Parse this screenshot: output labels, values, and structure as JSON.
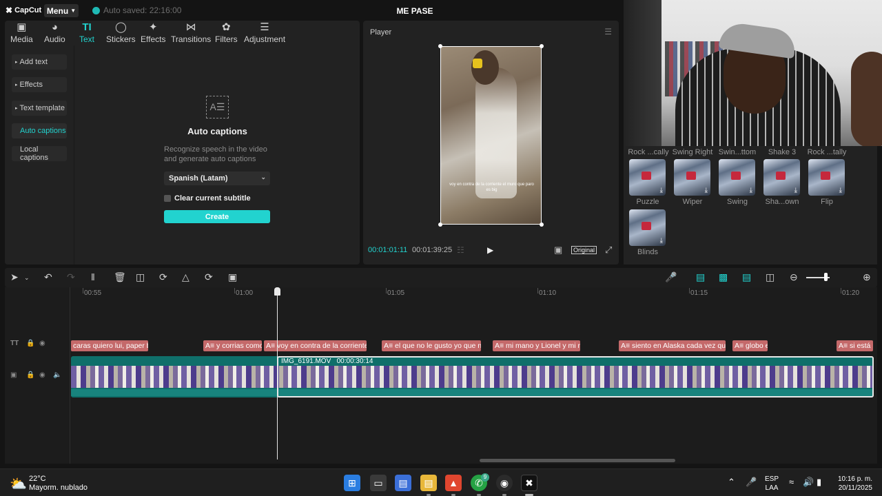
{
  "titlebar": {
    "logo": "CapCut",
    "menu_label": "Menu",
    "autosave": "Auto saved: 22:16:00",
    "project_title": "ME PASE"
  },
  "toolbar": {
    "tabs": [
      {
        "label": "Media",
        "icon": "media-icon"
      },
      {
        "label": "Audio",
        "icon": "audio-icon"
      },
      {
        "label": "Text",
        "icon": "text-icon",
        "active": true
      },
      {
        "label": "Stickers",
        "icon": "stickers-icon"
      },
      {
        "label": "Effects",
        "icon": "effects-icon"
      },
      {
        "label": "Transitions",
        "icon": "transitions-icon"
      },
      {
        "label": "Filters",
        "icon": "filters-icon"
      },
      {
        "label": "Adjustment",
        "icon": "adjustment-icon"
      }
    ]
  },
  "sidebar": {
    "items": [
      {
        "label": "Add text"
      },
      {
        "label": "Effects"
      },
      {
        "label": "Text template"
      },
      {
        "label": "Auto captions",
        "active": true
      },
      {
        "label": "Local captions"
      }
    ]
  },
  "auto_captions": {
    "icon_glyph": "A☰",
    "title": "Auto captions",
    "description": "Recognize speech in the video and generate auto captions",
    "language": "Spanish (Latam)",
    "clear_label": "Clear current subtitle",
    "create_label": "Create"
  },
  "player": {
    "title": "Player",
    "caption_overlay": "voy en contra de la corriente el muro que paro es big",
    "current_time": "00:01:01:11",
    "total_time": "00:01:39:25",
    "ratio_label": "Original"
  },
  "transitions": {
    "top_labels": [
      "Rock ...cally",
      "Swing Right",
      "Swin...ttom",
      "Shake 3",
      "Rock ...tally"
    ],
    "items": [
      {
        "name": "Puzzle"
      },
      {
        "name": "Wiper"
      },
      {
        "name": "Swing"
      },
      {
        "name": "Sha...own"
      },
      {
        "name": "Flip"
      },
      {
        "name": "Blinds"
      }
    ]
  },
  "timeline": {
    "ruler": [
      "00:55",
      "01:00",
      "01:05",
      "01:10",
      "01:15",
      "01:20"
    ],
    "captions": [
      "caras quiero lui, paper bl",
      "A≡ y corrias como",
      "A≡ voy en contra de la corriente e",
      "A≡ el que no le gusto yo que n",
      "A≡ mi mano y Lionel y mi m",
      "A≡ siento en Alaska cada vez que p",
      "A≡ globo e",
      "A≡ si está n"
    ],
    "clip_name": "IMG_6191.MOV",
    "clip_duration": "00:00:30:14"
  },
  "taskbar": {
    "temperature": "22°C",
    "weather": "Mayorm. nublado",
    "whatsapp_badge": "9",
    "lang_top": "ESP",
    "lang_bottom": "LAA",
    "time": "10:16 p. m.",
    "date": "20/11/2025"
  }
}
